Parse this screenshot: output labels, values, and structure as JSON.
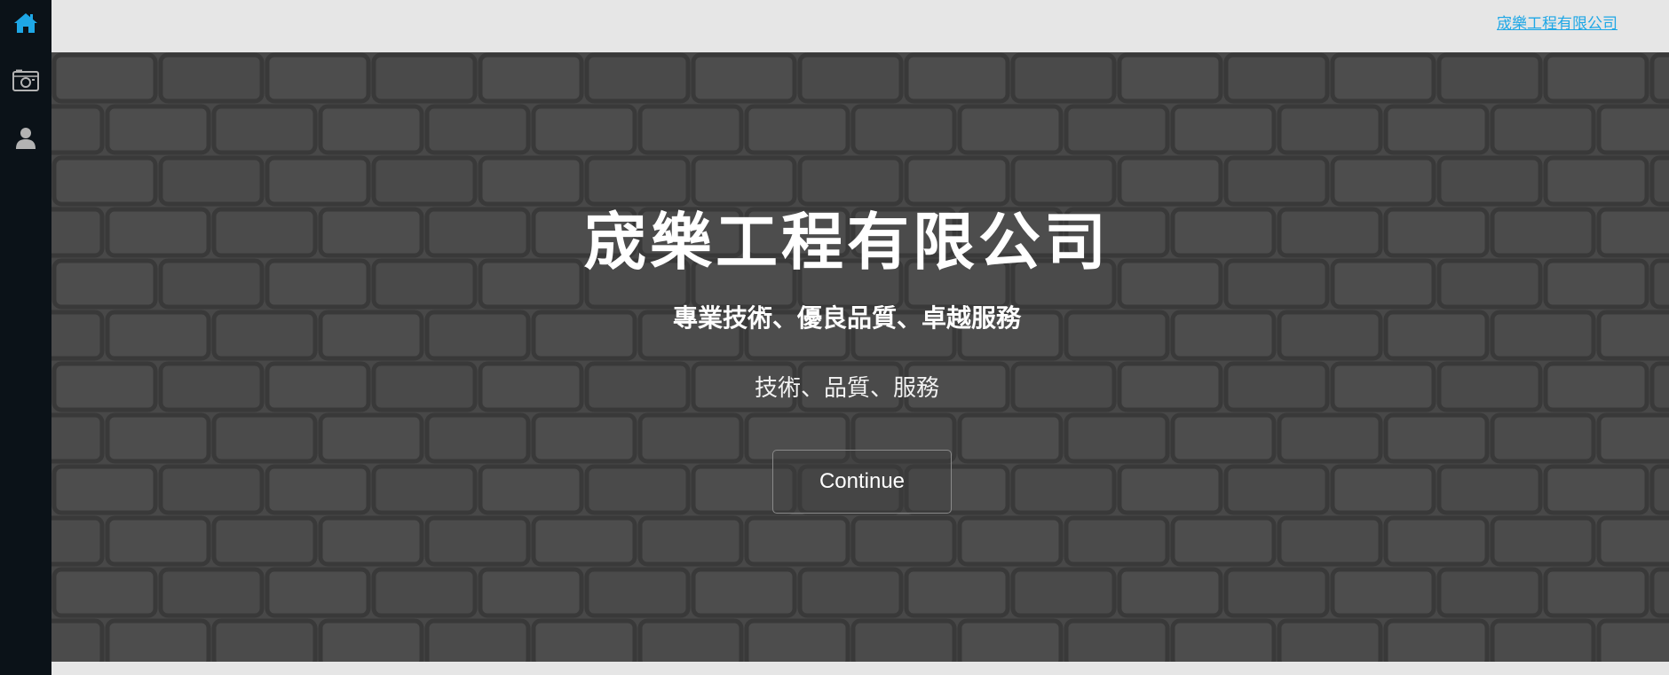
{
  "sidebar": {
    "items": [
      {
        "icon": "home-icon",
        "active": true,
        "color": "#1ea7e6"
      },
      {
        "icon": "camera-icon",
        "active": false,
        "color": "#b3b3b3"
      },
      {
        "icon": "user-icon",
        "active": false,
        "color": "#b3b3b3"
      }
    ]
  },
  "topbar": {
    "brand_link": "宬樂工程有限公司"
  },
  "hero": {
    "title": "宬樂工程有限公司",
    "subtitle": "專業技術、優良品質、卓越服務",
    "tagline": "技術、品質、服務",
    "button_label": "Continue",
    "background": "brick-wall-image"
  },
  "colors": {
    "accent": "#1ea7e6",
    "sidebar_bg": "#0b1218",
    "topbar_bg": "#e6e6e6",
    "hero_overlay": "#4b4b4b"
  }
}
